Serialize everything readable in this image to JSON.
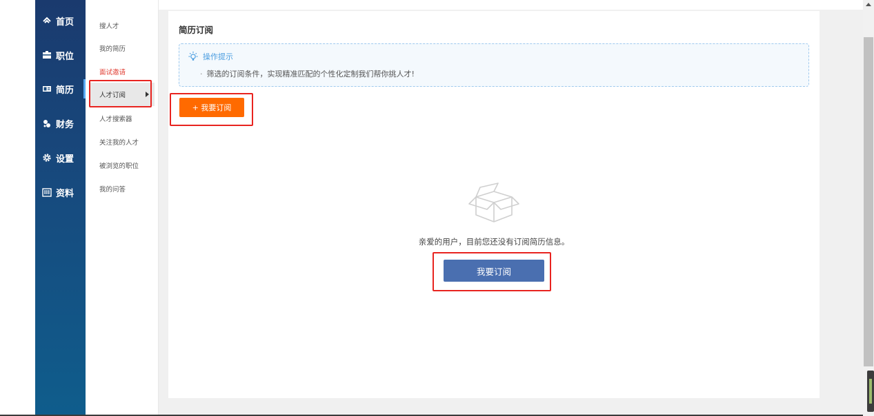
{
  "primary_nav": [
    {
      "label": "首页",
      "icon": "home-icon"
    },
    {
      "label": "职位",
      "icon": "briefcase-icon"
    },
    {
      "label": "简历",
      "icon": "id-card-icon"
    },
    {
      "label": "财务",
      "icon": "coins-icon"
    },
    {
      "label": "设置",
      "icon": "gear-icon"
    },
    {
      "label": "资料",
      "icon": "building-icon"
    }
  ],
  "secondary_nav": [
    {
      "label": "搜人才"
    },
    {
      "label": "我的简历"
    },
    {
      "label": "面试邀请"
    },
    {
      "label": "人才订阅"
    },
    {
      "label": "人才搜索器"
    },
    {
      "label": "关注我的人才"
    },
    {
      "label": "被浏览的职位"
    },
    {
      "label": "我的问答"
    }
  ],
  "main": {
    "title": "简历订阅",
    "tip": {
      "heading": "操作提示",
      "line": "筛选的订阅条件，实现精准匹配的个性化定制我们帮你挑人才!"
    },
    "add_button_label": "+ 我要订阅",
    "empty_message": "亲爱的用户，目前您还没有订阅简历信息。",
    "subscribe_button_label": "我要订阅"
  },
  "colors": {
    "nav_gradient_top": "#1a3a6e",
    "nav_gradient_bottom": "#0f5d8c",
    "orange_button": "#ff6a00",
    "blue_button": "#4a6fb0",
    "highlight_red": "#e8231f",
    "tip_blue": "#4a9de0",
    "active_red_text": "#e03c31"
  }
}
